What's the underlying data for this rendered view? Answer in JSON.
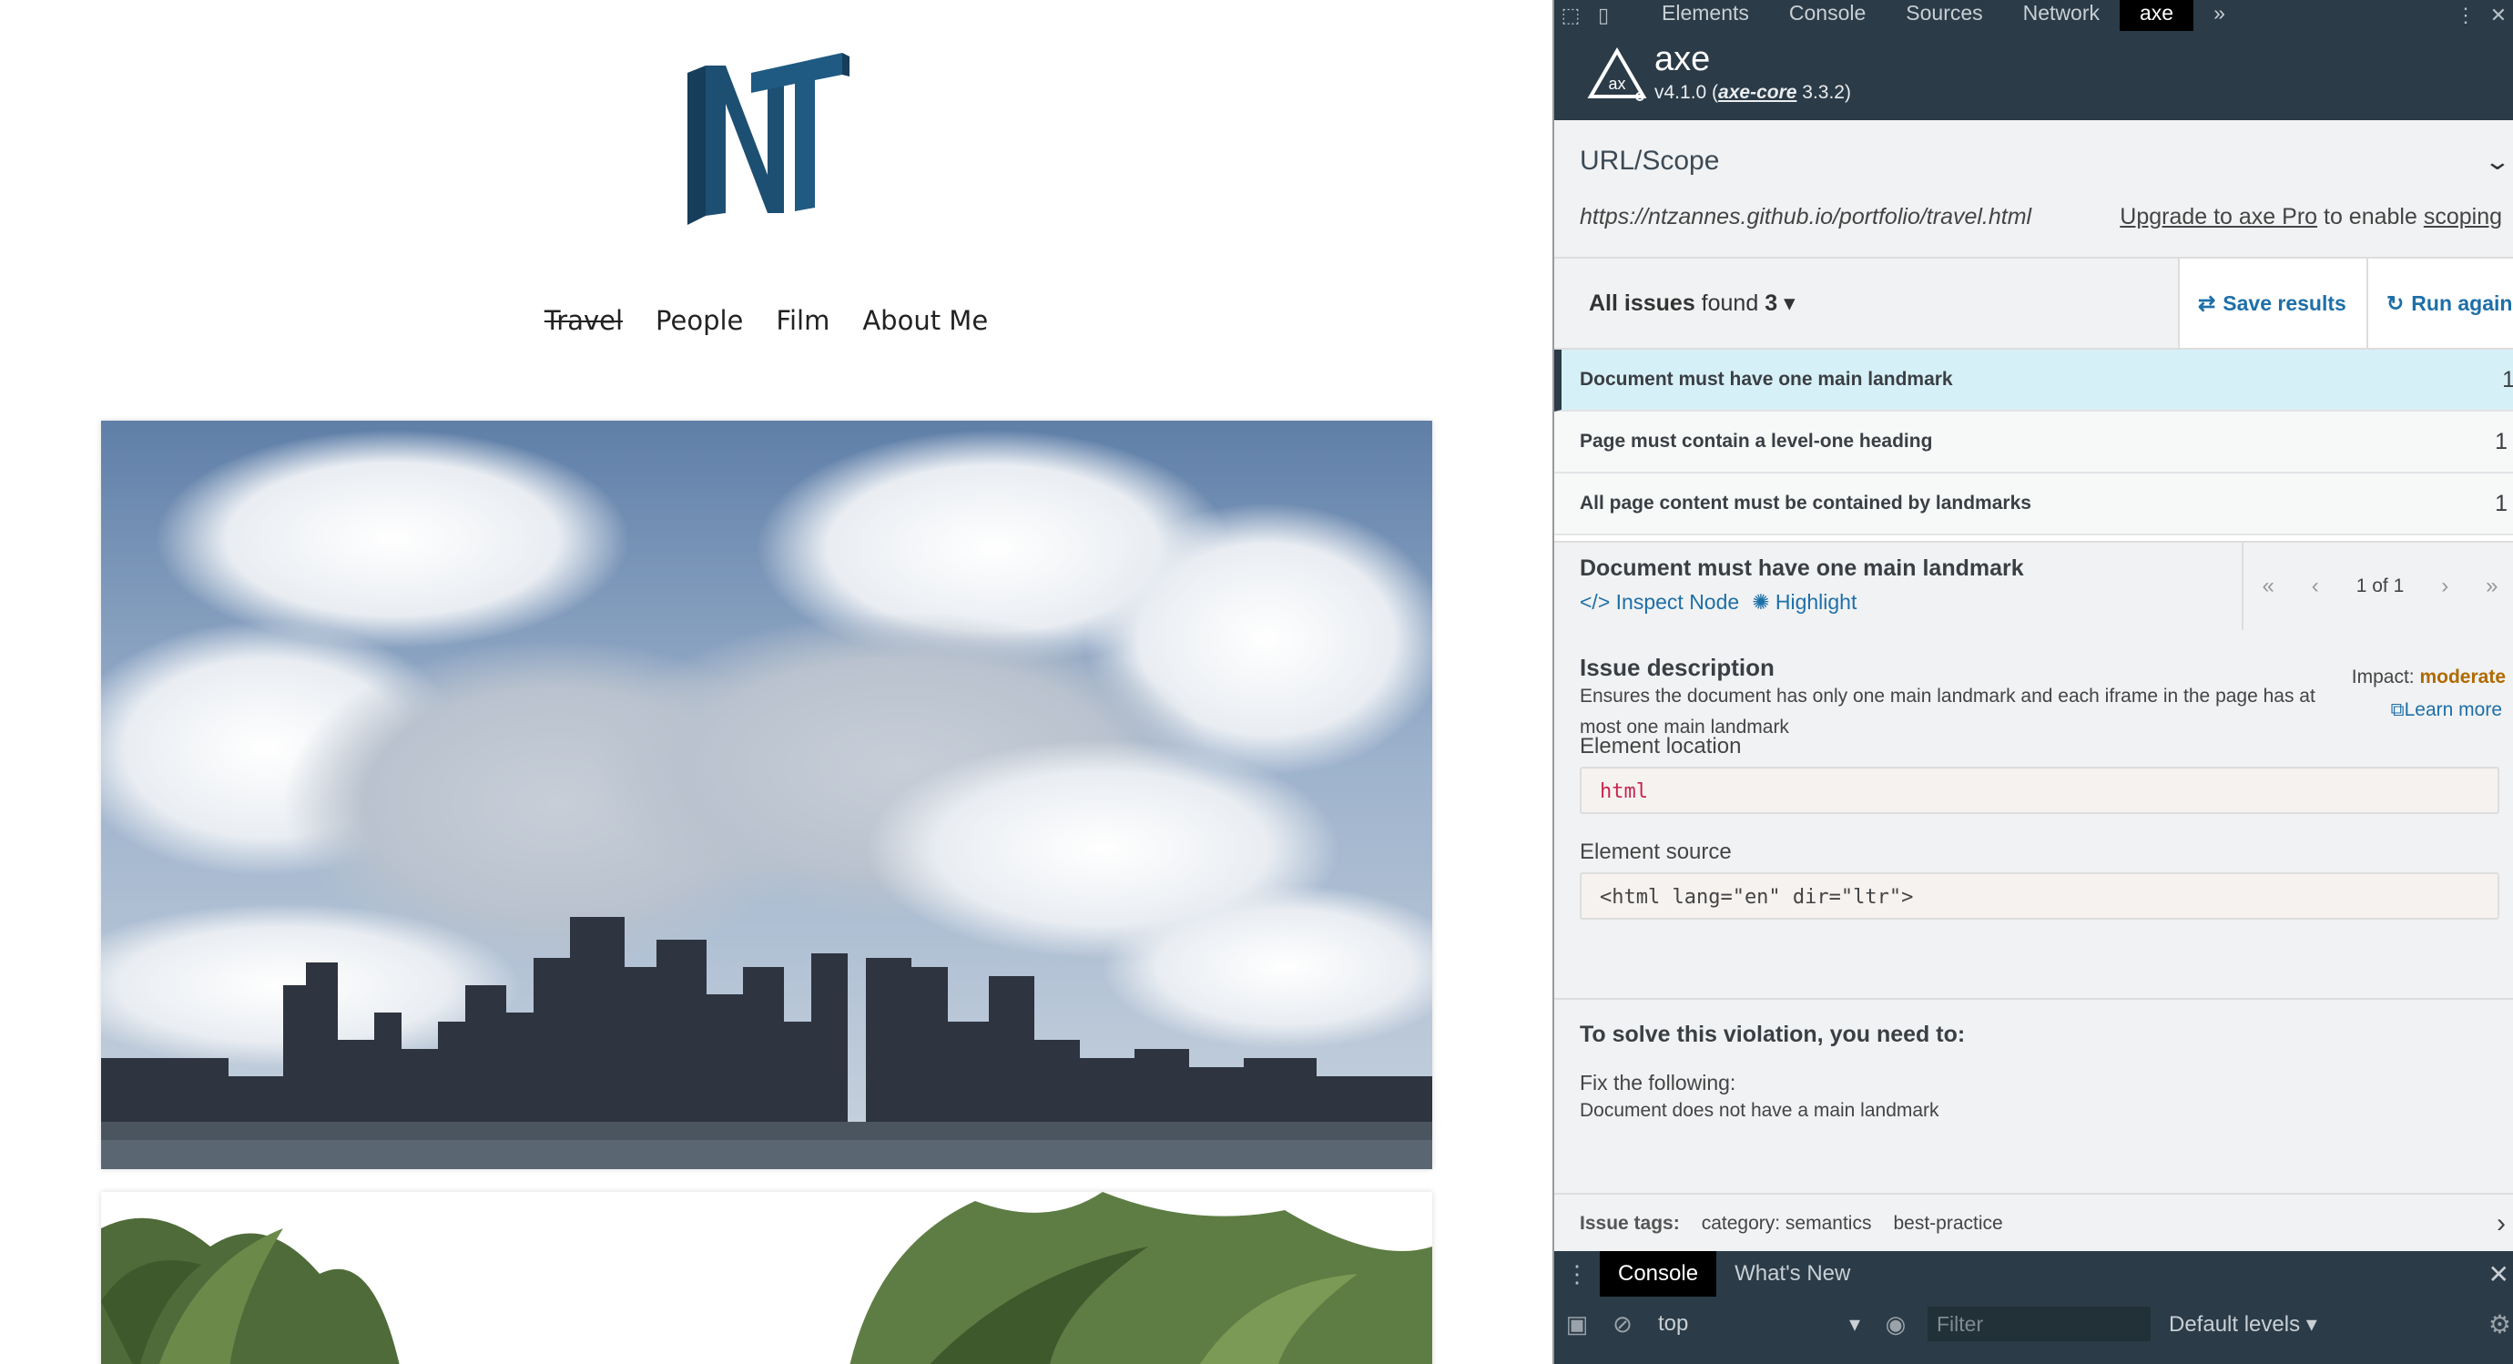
{
  "site": {
    "logo_alt": "NT",
    "nav": [
      {
        "label": "Travel"
      },
      {
        "label": "People"
      },
      {
        "label": "Film"
      },
      {
        "label": "About Me"
      }
    ]
  },
  "devtools": {
    "tabs": [
      {
        "label": "Elements"
      },
      {
        "label": "Console"
      },
      {
        "label": "Sources"
      },
      {
        "label": "Network"
      },
      {
        "label": "axe"
      }
    ],
    "overflow_glyph": "»",
    "axe": {
      "name": "axe",
      "version_prefix": "v4.1.0 (",
      "core_link": "axe-core",
      "version_suffix": " 3.3.2)"
    },
    "scope": {
      "title": "URL/Scope",
      "url": "https://ntzannes.github.io/portfolio/travel.html",
      "upgrade_link": "Upgrade to axe Pro",
      "upgrade_mid": " to enable ",
      "scoping_link": "scoping"
    },
    "summary": {
      "all_issues": "All issues",
      "found": " found ",
      "count": "3",
      "save": "Save results",
      "run": "Run again"
    },
    "issues": [
      {
        "label": "Document must have one main landmark",
        "count": "1"
      },
      {
        "label": "Page must contain a level-one heading",
        "count": "1"
      },
      {
        "label": "All page content must be contained by landmarks",
        "count": "1"
      }
    ],
    "detail": {
      "title": "Document must have one main landmark",
      "inspect": "Inspect Node",
      "highlight": "Highlight",
      "pager": "1 of 1",
      "desc_heading": "Issue description",
      "desc_text": "Ensures the document has only one main landmark and each iframe in the page has at most one main landmark",
      "impact_label": "Impact: ",
      "impact_value": "moderate",
      "learn_more": "Learn more",
      "location_label": "Element location",
      "location_value": "html",
      "source_label": "Element source",
      "source_value": "<html lang=\"en\" dir=\"ltr\">",
      "solve_heading": "To solve this violation, you need to:",
      "fix_label": "Fix the following:",
      "fix_text": "Document does not have a main landmark"
    },
    "tags": {
      "label": "Issue tags:",
      "items": [
        "category: semantics",
        "best-practice"
      ]
    },
    "console": {
      "tabs": [
        "Console",
        "What's New"
      ],
      "context": "top",
      "filter_placeholder": "Filter",
      "levels": "Default levels ▾"
    }
  },
  "colors": {
    "devtools_dark": "#2b3b47",
    "link_blue": "#1e6fa8",
    "selected_row": "#d6f0f7",
    "impact_moderate": "#b06a00",
    "logo_blue": "#1d4f73"
  }
}
